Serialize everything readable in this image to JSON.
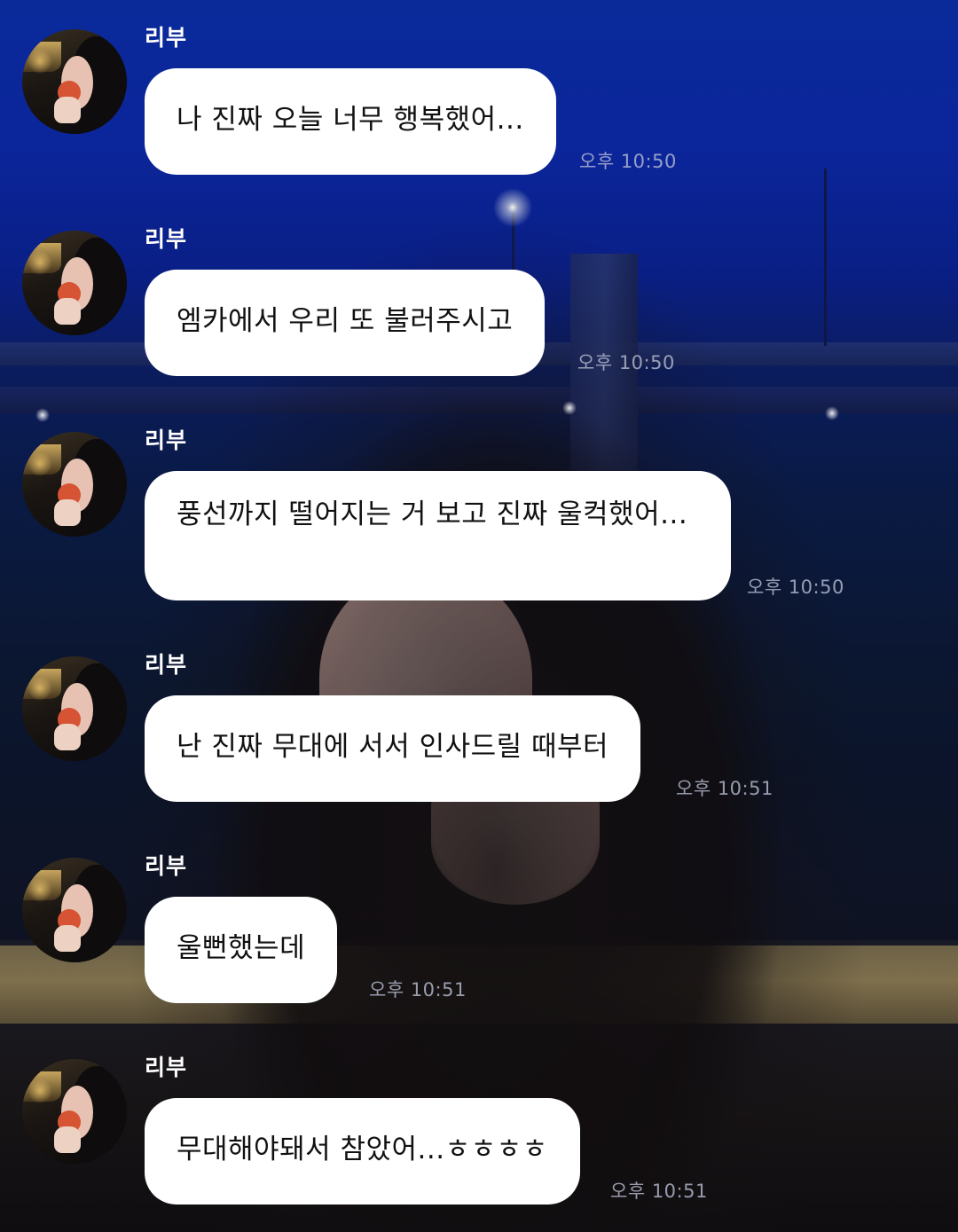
{
  "chat": {
    "messages": [
      {
        "sender": "리부",
        "text": "나 진짜 오늘 너무 행복했어...",
        "time": "오후 10:50"
      },
      {
        "sender": "리부",
        "text": "엠카에서 우리 또 불러주시고",
        "time": "오후 10:50"
      },
      {
        "sender": "리부",
        "text": "풍선까지 떨어지는 거 보고 진짜 울컥했어...",
        "time": "오후 10:50"
      },
      {
        "sender": "리부",
        "text": "난 진짜 무대에 서서 인사드릴 때부터",
        "time": "오후 10:51"
      },
      {
        "sender": "리부",
        "text": "울뻔했는데",
        "time": "오후 10:51"
      },
      {
        "sender": "리부",
        "text": "무대해야돼서 참았어...ㅎㅎㅎㅎ",
        "time": "오후 10:51"
      }
    ]
  },
  "icons": {
    "avatar": "profile-photo-avatar"
  },
  "colors": {
    "bubble_bg": "#ffffff",
    "bubble_text": "#111111",
    "name_text": "#ffffff",
    "time_text": "#bec3d7"
  }
}
